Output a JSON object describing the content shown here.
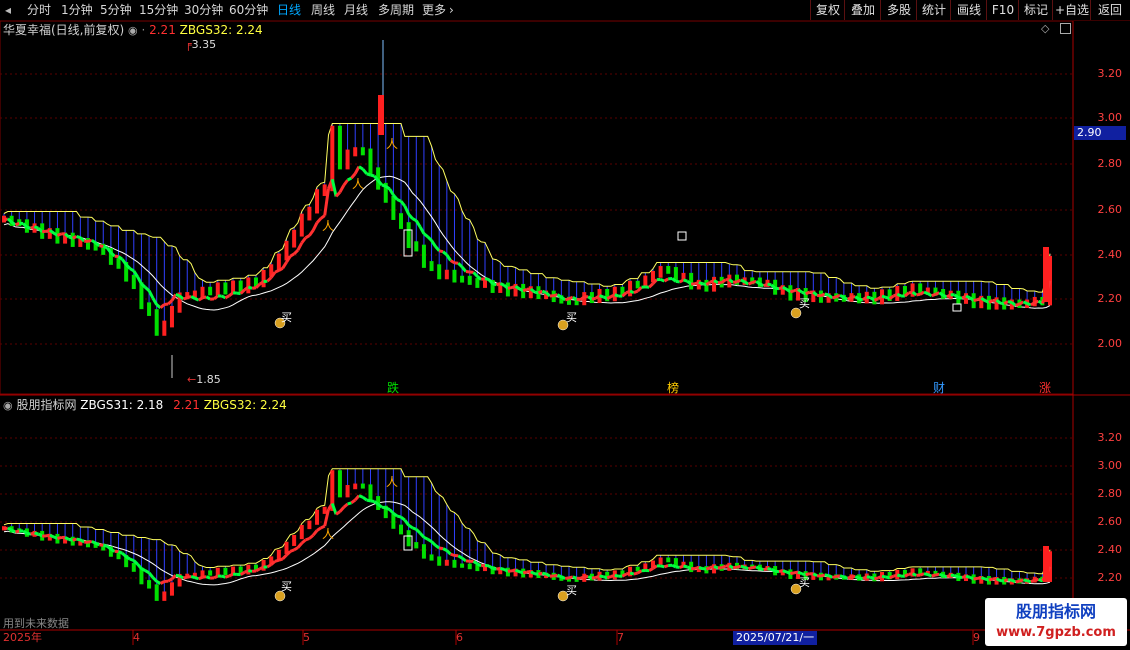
{
  "toolbar": {
    "left": [
      {
        "label": "分时",
        "active": false
      },
      {
        "label": "1分钟",
        "active": false
      },
      {
        "label": "5分钟",
        "active": false
      },
      {
        "label": "15分钟",
        "active": false
      },
      {
        "label": "30分钟",
        "active": false
      },
      {
        "label": "60分钟",
        "active": false
      },
      {
        "label": "日线",
        "active": true
      },
      {
        "label": "周线",
        "active": false
      },
      {
        "label": "月线",
        "active": false
      },
      {
        "label": "多周期",
        "active": false
      },
      {
        "label": "更多",
        "active": false
      }
    ],
    "right": [
      "复权",
      "叠加",
      "多股",
      "统计",
      "画线",
      "F10",
      "标记",
      "+自选",
      "返回"
    ]
  },
  "main_panel": {
    "name": "华夏幸福(日线,前复权)",
    "value1": "2.21",
    "zbgs32_label": "ZBGS32:",
    "zbgs32_value": "2.24",
    "axis": [
      "3.20",
      "3.00",
      "2.80",
      "2.60",
      "2.40",
      "2.20",
      "2.00"
    ],
    "current_price": "2.90",
    "high_label": "3.35",
    "low_label": "1.85",
    "events": [
      {
        "text": "跌",
        "color": "#00e000"
      },
      {
        "text": "榜",
        "color": "#ffcc00"
      },
      {
        "text": "财",
        "color": "#3399ff"
      },
      {
        "text": "涨",
        "color": "#ff3030"
      }
    ]
  },
  "indicator_panel": {
    "name": "股朋指标网",
    "zbgs31_label": "ZBGS31:",
    "zbgs31_value": "2.18",
    "value2": "2.21",
    "zbgs32_label": "ZBGS32:",
    "zbgs32_value": "2.24",
    "axis": [
      "3.20",
      "3.00",
      "2.80",
      "2.60",
      "2.40",
      "2.20"
    ]
  },
  "bottom_note": "用到未来数据",
  "date_axis": {
    "labels": [
      "2025年",
      "4",
      "5",
      "6",
      "7",
      "9"
    ],
    "cursor_date": "2025/07/21/一"
  },
  "signals": {
    "buy": "买",
    "weak": "跌"
  },
  "watermark": {
    "title": "股朋指标网",
    "url": "www.7gpzb.com"
  },
  "colors": {
    "up": "#ff2020",
    "down": "#00e000",
    "line_red": "#ff3030",
    "line_green": "#00ff40",
    "band": "#3040ff",
    "upper": "#ffff60",
    "ma": "#ffffff"
  }
}
